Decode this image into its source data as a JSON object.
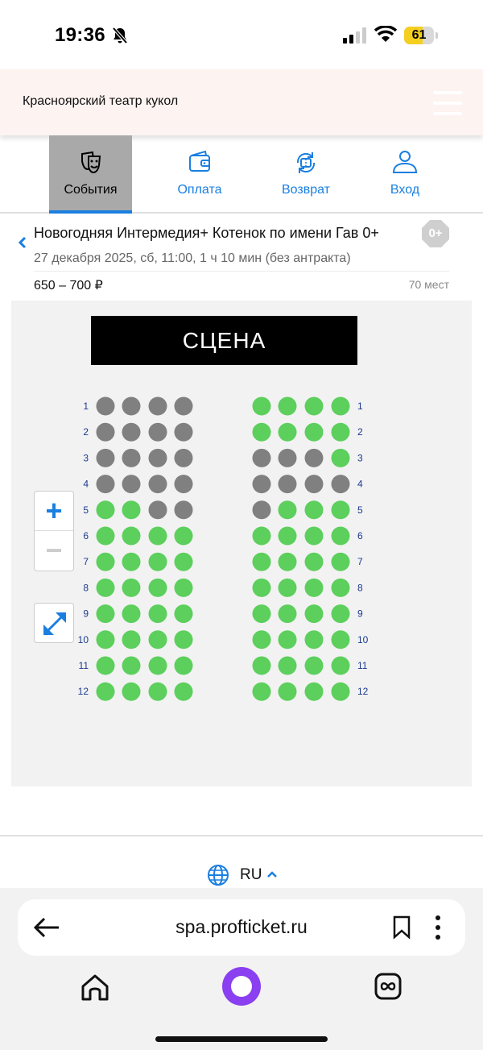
{
  "status_bar": {
    "time": "19:36",
    "battery": "61",
    "battery_level": 0.61,
    "icons": [
      "bell-slash-icon",
      "signal-icon",
      "wifi-icon",
      "battery-icon"
    ]
  },
  "header": {
    "theater_name": "Красноярский театр кукол",
    "menu_icon": "hamburger-menu-icon"
  },
  "nav": {
    "tabs": [
      {
        "label": "События",
        "icon": "theater-masks-icon",
        "active": true
      },
      {
        "label": "Оплата",
        "icon": "wallet-icon",
        "active": false
      },
      {
        "label": "Возврат",
        "icon": "ticket-return-icon",
        "active": false
      },
      {
        "label": "Вход",
        "icon": "user-icon",
        "active": false
      }
    ]
  },
  "event": {
    "title": "Новогодняя Интермедия+ Котенок по имени Гав 0+",
    "age_rating": "0+",
    "date": "27 декабря 2025, сб, 11:00, 1 ч 10 мин (без антракта)",
    "price": "650 – 700 ₽",
    "seats": "70 мест"
  },
  "seat_map": {
    "stage_label": "СЦЕНА",
    "colors": {
      "available": "#5ccf5c",
      "taken": "#808080"
    },
    "row_labels": [
      "1",
      "2",
      "3",
      "4",
      "5",
      "6",
      "7",
      "8",
      "9",
      "10",
      "11",
      "12"
    ],
    "zoom_in": "+",
    "zoom_out": "−",
    "left_block": [
      [
        0,
        0,
        0,
        0
      ],
      [
        0,
        0,
        0,
        0
      ],
      [
        0,
        0,
        0,
        0
      ],
      [
        0,
        0,
        0,
        0
      ],
      [
        1,
        1,
        0,
        0
      ],
      [
        1,
        1,
        1,
        1
      ],
      [
        1,
        1,
        1,
        1
      ],
      [
        1,
        1,
        1,
        1
      ],
      [
        1,
        1,
        1,
        1
      ],
      [
        1,
        1,
        1,
        1
      ],
      [
        1,
        1,
        1,
        1
      ],
      [
        1,
        1,
        1,
        1
      ]
    ],
    "right_block": [
      [
        1,
        1,
        1,
        1
      ],
      [
        1,
        1,
        1,
        1
      ],
      [
        0,
        0,
        0,
        1
      ],
      [
        0,
        0,
        0,
        0
      ],
      [
        0,
        1,
        1,
        1
      ],
      [
        1,
        1,
        1,
        1
      ],
      [
        1,
        1,
        1,
        1
      ],
      [
        1,
        1,
        1,
        1
      ],
      [
        1,
        1,
        1,
        1
      ],
      [
        1,
        1,
        1,
        1
      ],
      [
        1,
        1,
        1,
        1
      ],
      [
        1,
        1,
        1,
        1
      ]
    ]
  },
  "language": {
    "label": "RU"
  },
  "browser": {
    "url": "spa.profticket.ru",
    "icons": [
      "back-arrow-icon",
      "bookmark-icon",
      "more-icon",
      "home-icon",
      "alice-icon",
      "tabs-icon"
    ]
  }
}
